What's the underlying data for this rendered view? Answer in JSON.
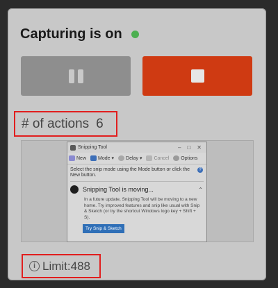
{
  "header": {
    "title": "Capturing is on",
    "status_color": "#4caf50"
  },
  "controls": {
    "pause_icon": "pause-icon",
    "stop_icon": "stop-icon",
    "stop_color": "#cf3a12"
  },
  "actions": {
    "label": "# of actions",
    "count": "6"
  },
  "thumbnail": {
    "window_title": "Snipping Tool",
    "window_controls": [
      "–",
      "□",
      "✕"
    ],
    "toolbar": [
      "New",
      "Mode",
      "Delay",
      "Cancel",
      "Options"
    ],
    "info_text": "Select the snip mode using the Mode button or click the New button.",
    "notice_title": "Snipping Tool is moving...",
    "notice_body": "In a future update, Snipping Tool will be moving to a new home. Try improved features and snip like usual with Snip & Sketch (or try the shortcut Windows logo key + Shift + S).",
    "notice_button": "Try Snip & Sketch"
  },
  "limit": {
    "text": "Limit:488"
  }
}
